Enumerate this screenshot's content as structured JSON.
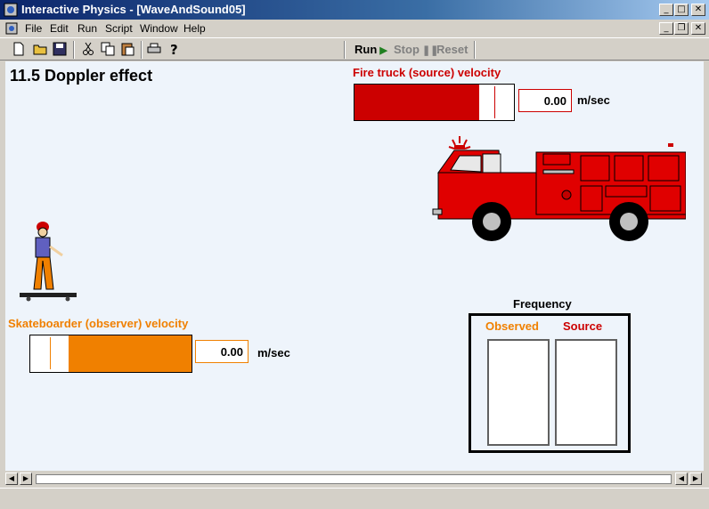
{
  "window": {
    "title": "Interactive Physics - [WaveAndSound05]"
  },
  "menu": {
    "items": [
      {
        "label": "File"
      },
      {
        "label": "Edit"
      },
      {
        "label": "Run"
      },
      {
        "label": "Script"
      },
      {
        "label": "Window"
      },
      {
        "label": "Help"
      }
    ]
  },
  "toolbar": {
    "run_label": "Run",
    "stop_label": "Stop",
    "reset_label": "Reset"
  },
  "workspace": {
    "title": "11.5 Doppler effect",
    "source_velocity": {
      "label": "Fire truck (source) velocity",
      "value": "0.00",
      "unit": "m/sec",
      "fill_fraction": 0.78
    },
    "observer_velocity": {
      "label": "Skateboarder (observer) velocity",
      "value": "0.00",
      "unit": "m/sec",
      "fill_fraction": 0.76
    },
    "frequency": {
      "title": "Frequency",
      "observed_label": "Observed",
      "source_label": "Source"
    }
  },
  "colors": {
    "red": "#cc0000",
    "orange": "#f08000",
    "canvas": "#eef4fb"
  }
}
